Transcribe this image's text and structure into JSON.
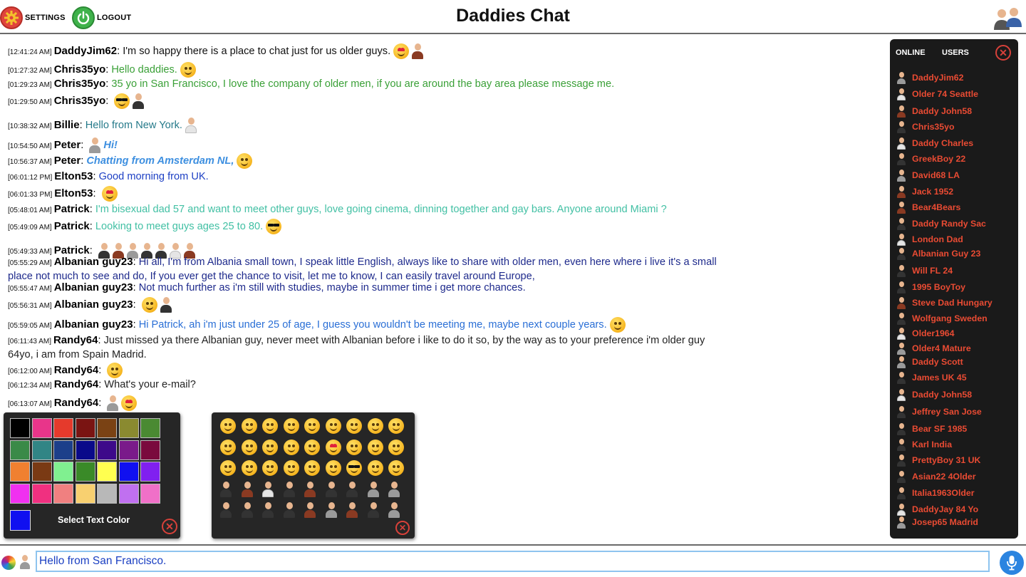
{
  "header": {
    "title": "Daddies Chat",
    "settings_label": "SETTINGS",
    "logout_label": "LOGOUT"
  },
  "messages": [
    {
      "time": "[12:41:24 AM]",
      "user": "DaddyJim62",
      "text": "I'm so happy there is a place to chat just for us older guys.",
      "color": "#111111",
      "style": "normal",
      "icons": [
        "heart-eyes-emoji",
        "avatar-brown"
      ]
    },
    {
      "time": "[01:27:32 AM]",
      "user": "Chris35yo",
      "text": "Hello daddies.",
      "color": "#3aa037",
      "style": "normal",
      "icons": [
        "innocent-emoji"
      ]
    },
    {
      "time": "[01:29:23 AM]",
      "user": "Chris35yo",
      "text": "35 yo in San Francisco, I love the company of older men, if you are around the bay area please message me.",
      "color": "#3aa037",
      "style": "normal",
      "icons": []
    },
    {
      "time": "[01:29:50 AM]",
      "user": "Chris35yo",
      "text": "",
      "color": "#3aa037",
      "style": "normal",
      "icons": [
        "sunglasses-emoji",
        "avatar-dark"
      ]
    },
    {
      "time": "[10:38:32 AM]",
      "user": "Billie",
      "text": "Hello from New York.",
      "color": "#267a8a",
      "style": "normal",
      "icons": [
        "avatar-white"
      ]
    },
    {
      "time": "[10:54:50 AM]",
      "user": "Peter",
      "text": "Hi!",
      "color": "#3d8fe0",
      "style": "bolditalic",
      "icons_before": [
        "avatar-grey"
      ],
      "icons": []
    },
    {
      "time": "[10:56:37 AM]",
      "user": "Peter",
      "text": "Chatting from Amsterdam NL,",
      "color": "#3d8fe0",
      "style": "bolditalic",
      "icons": [
        "smile-emoji"
      ]
    },
    {
      "time": "[06:01:12 PM]",
      "user": "Elton53",
      "text": "Good morning from UK.",
      "color": "#1c3fc4",
      "style": "normal",
      "icons": []
    },
    {
      "time": "[06:01:33 PM]",
      "user": "Elton53",
      "text": "",
      "color": "#1c3fc4",
      "style": "normal",
      "icons": [
        "heart-eyes-emoji"
      ]
    },
    {
      "time": "[05:48:01 AM]",
      "user": "Patrick",
      "text": "I'm bisexual dad 57 and want to meet other guys, love going cinema, dinning together and gay bars. Anyone around Miami ?",
      "color": "#42c0a4",
      "style": "normal",
      "icons": []
    },
    {
      "time": "[05:49:09 AM]",
      "user": "Patrick",
      "text": "Looking to meet guys ages 25 to 80.",
      "color": "#42c0a4",
      "style": "normal",
      "icons": [
        "sunglasses-emoji"
      ]
    },
    {
      "time": "[05:49:33 AM]",
      "user": "Patrick",
      "text": "",
      "color": "#42c0a4",
      "style": "normal",
      "icons": [
        "avatar-dark",
        "avatar-brown",
        "avatar-grey",
        "avatar-dark",
        "avatar-dark",
        "avatar-white",
        "avatar-brown"
      ]
    },
    {
      "time": "[05:55:29 AM]",
      "user": "Albanian guy23",
      "text": "Hi all, I'm from Albania small town, I speak little English, always like to share with older men, even here where i live it's a small place not much to see and do, If you ever get the chance to visit, let me to know, I can easily travel around Europe,",
      "color": "#1e2a8c",
      "style": "normal",
      "icons": []
    },
    {
      "time": "[05:55:47 AM]",
      "user": "Albanian guy23",
      "text": "Not much further as i'm still with studies, maybe in summer time i get more chances.",
      "color": "#1e2a8c",
      "style": "normal",
      "icons": []
    },
    {
      "time": "[05:56:31 AM]",
      "user": "Albanian guy23",
      "text": "",
      "color": "#1e2a8c",
      "style": "normal",
      "icons": [
        "innocent-emoji",
        "avatar-dark"
      ]
    },
    {
      "time": "[05:59:05 AM]",
      "user": "Albanian guy23",
      "text": "Hi Patrick, ah i'm just under 25 of age, I guess you wouldn't be meeting me, maybe next couple years.",
      "color": "#2a6fd6",
      "style": "normal",
      "icons": [
        "grin-emoji"
      ]
    },
    {
      "time": "[06:11:43 AM]",
      "user": "Randy64",
      "text": "Just missed ya there Albanian guy, never meet with Albanian before i like to do it so, by the way as to your preference i'm older guy 64yo, i am from Spain Madrid.",
      "color": "#222222",
      "style": "normal",
      "icons": []
    },
    {
      "time": "[06:12:00 AM]",
      "user": "Randy64",
      "text": "",
      "color": "#222222",
      "style": "normal",
      "icons": [
        "smile-emoji"
      ]
    },
    {
      "time": "[06:12:34 AM]",
      "user": "Randy64",
      "text": "What's your e-mail?",
      "color": "#222222",
      "style": "normal",
      "icons": []
    },
    {
      "time": "[06:13:07 AM]",
      "user": "Randy64",
      "text": "",
      "color": "#222222",
      "style": "normal",
      "icons": [
        "avatar-grey",
        "heart-eyes-emoji"
      ]
    }
  ],
  "color_picker": {
    "label": "Select Text Color",
    "swatches": [
      "#000000",
      "#e8358a",
      "#e53a2c",
      "#7a1412",
      "#7a4214",
      "#8a8a30",
      "#4a8a32",
      "#3a8a48",
      "#318585",
      "#1c3f8a",
      "#0a0a8a",
      "#3d0a8a",
      "#7a1a8a",
      "#7a0a3d",
      "#f08030",
      "#7a3a14",
      "#80f090",
      "#3a8a28",
      "#ffff50",
      "#1010f0",
      "#8020f0",
      "#f030f0",
      "#f03080",
      "#f08080",
      "#f8d070",
      "#b8b8b8",
      "#c070f0",
      "#f070c8"
    ],
    "selected": "#1010f0"
  },
  "emoji_picker": {
    "items": [
      "grin-emoji",
      "astonished-emoji",
      "bandage-emoji",
      "sweat-emoji",
      "confounded-emoji",
      "confused-emoji",
      "cold-sweat-emoji",
      "disappointed-emoji",
      "dizzy-emoji",
      "fearful-emoji",
      "frowning-emoji",
      "grimace-emoji",
      "grin-emoji",
      "innocent-emoji",
      "heart-eyes-emoji",
      "kissing-emoji",
      "laughing-emoji",
      "open-mouth-emoji",
      "pensive-emoji",
      "angry-emoji",
      "relieved-emoji",
      "rolling-eyes-emoji",
      "smile-emoji",
      "smirk-emoji",
      "sunglasses-emoji",
      "tongue-emoji",
      "wink-emoji",
      "avatar-dark",
      "avatar-brown",
      "avatar-white",
      "avatar-dark",
      "avatar-brown",
      "avatar-dark",
      "avatar-dark",
      "avatar-grey",
      "avatar-grey",
      "avatar-dark",
      "avatar-dark",
      "avatar-dark",
      "avatar-dark",
      "avatar-brown",
      "avatar-grey",
      "avatar-brown",
      "avatar-dark",
      "avatar-grey"
    ]
  },
  "users_panel": {
    "tab_online": "ONLINE",
    "tab_users": "USERS",
    "users": [
      {
        "name": "DaddyJim62",
        "avatar": "grey"
      },
      {
        "name": "Older 74 Seattle",
        "avatar": "white"
      },
      {
        "name": "Daddy John58",
        "avatar": "brown"
      },
      {
        "name": "Chris35yo",
        "avatar": "dark"
      },
      {
        "name": "Daddy Charles",
        "avatar": "white"
      },
      {
        "name": "GreekBoy 22",
        "avatar": "dark"
      },
      {
        "name": "David68 LA",
        "avatar": "grey"
      },
      {
        "name": "Jack 1952",
        "avatar": "brown"
      },
      {
        "name": "Bear4Bears",
        "avatar": "brown"
      },
      {
        "name": "Daddy Randy Sac",
        "avatar": "dark"
      },
      {
        "name": "London Dad",
        "avatar": "white"
      },
      {
        "name": "Albanian Guy 23",
        "avatar": "dark"
      },
      {
        "name": "Will FL 24",
        "avatar": "dark"
      },
      {
        "name": "1995 BoyToy",
        "avatar": "dark"
      },
      {
        "name": "Steve Dad Hungary",
        "avatar": "brown"
      },
      {
        "name": "Wolfgang Sweden",
        "avatar": "dark"
      },
      {
        "name": "Older1964",
        "avatar": "white"
      },
      {
        "name": "Older4 Mature",
        "avatar": "grey"
      },
      {
        "name": "Daddy Scott",
        "avatar": "grey"
      },
      {
        "name": "James UK 45",
        "avatar": "dark"
      },
      {
        "name": "Daddy John58",
        "avatar": "white"
      },
      {
        "name": "Jeffrey San Jose",
        "avatar": "dark"
      },
      {
        "name": "Bear SF 1985",
        "avatar": "dark"
      },
      {
        "name": "Karl India",
        "avatar": "dark"
      },
      {
        "name": "PrettyBoy 31 UK",
        "avatar": "dark"
      },
      {
        "name": "Asian22 4Older",
        "avatar": "dark"
      },
      {
        "name": "Italia1963Older",
        "avatar": "dark"
      },
      {
        "name": "DaddyJay 84 Yo",
        "avatar": "white"
      },
      {
        "name": "Josep65 Madrid",
        "avatar": "grey"
      }
    ]
  },
  "input": {
    "value": "Hello from San Francisco.",
    "placeholder": ""
  },
  "colors": {
    "accent_red": "#d8413a",
    "accent_green": "#3fb24b",
    "user_name": "#e94b33",
    "panel_bg": "#1a1a1a",
    "mic_blue": "#2b84e0"
  }
}
